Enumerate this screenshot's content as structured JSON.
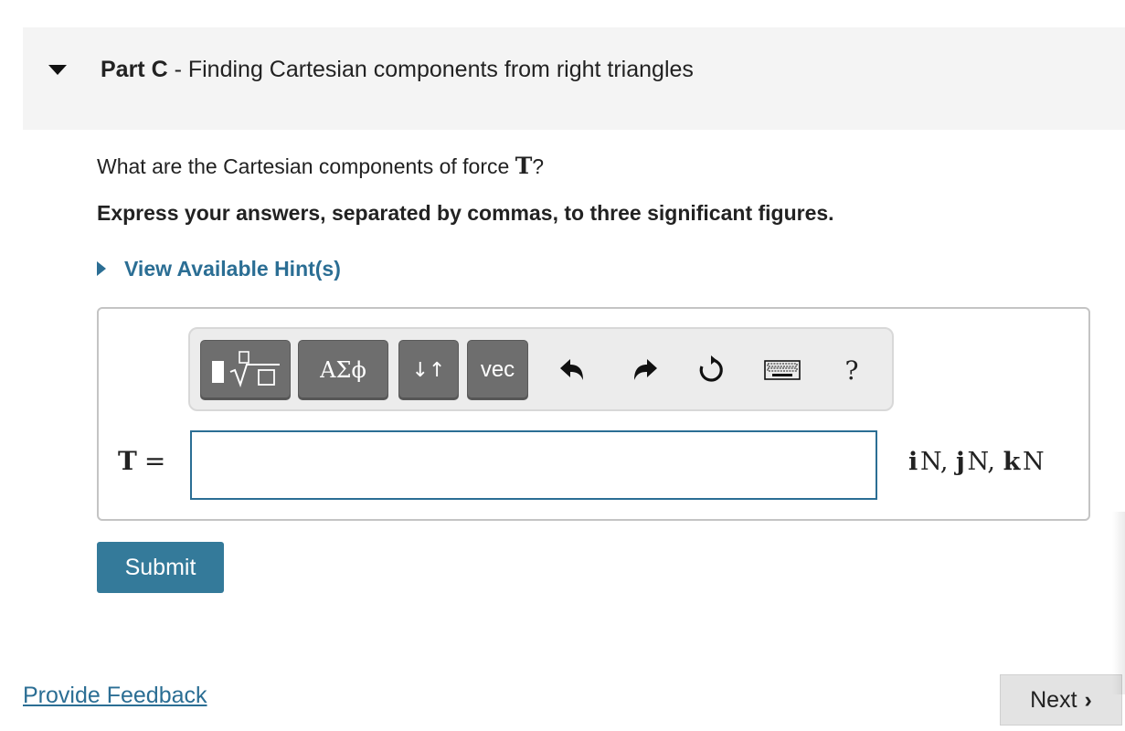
{
  "part": {
    "label": "Part C",
    "separator": " - ",
    "title": "Finding Cartesian components from right triangles"
  },
  "question": {
    "text": "What are the Cartesian components of force ",
    "symbol": "T",
    "suffix": "?",
    "instruction": "Express your answers, separated by commas, to three significant figures."
  },
  "hints": {
    "label": "View Available Hint(s)"
  },
  "toolbar": {
    "template_icon": "template-sqrt-icon",
    "greek_label": "ΑΣϕ",
    "arrows_label": "↓↑",
    "vec_label": "vec",
    "undo_icon": "undo-icon",
    "redo_icon": "redo-icon",
    "reset_icon": "reset-icon",
    "keyboard_icon": "keyboard-icon",
    "help_label": "?"
  },
  "answer": {
    "variable": "T",
    "equals": "=",
    "value": "",
    "units": {
      "i": "i",
      "i_unit": "N, ",
      "j": "j",
      "j_unit": "N, ",
      "k": "k",
      "k_unit": "N"
    }
  },
  "submit_label": "Submit",
  "feedback_label": "Provide Feedback",
  "next": {
    "label": "Next",
    "chevron": "›"
  },
  "colors": {
    "accent": "#2b6e94",
    "submit_bg": "#347a9a",
    "toolbar_button": "#6e6e6e",
    "header_bg": "#f4f4f4"
  }
}
